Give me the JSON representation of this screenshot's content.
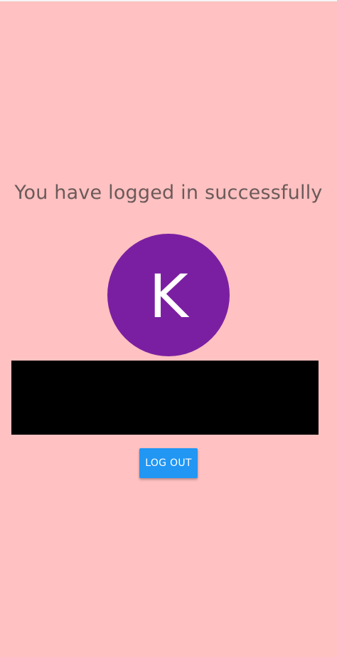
{
  "message": {
    "text": "You have logged in successfully"
  },
  "avatar": {
    "initial": "K",
    "color": "#7b1fa2"
  },
  "logout_button": {
    "label": "LOG OUT",
    "color": "#2196f3"
  },
  "colors": {
    "background": "#ffc1c1",
    "message_text": "#6b5a5a",
    "redacted": "#000000"
  }
}
